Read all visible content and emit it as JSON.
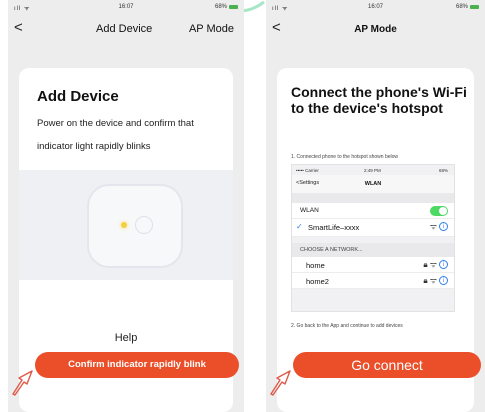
{
  "left_screen": {
    "status": {
      "time": "16:07",
      "battery": "68%"
    },
    "nav": {
      "back": "<",
      "title": "Add Device",
      "right_button": "AP Mode"
    },
    "card": {
      "title": "Add Device",
      "description": "Power on the device and confirm that indicator light rapidly blinks",
      "help": "Help",
      "confirm_button": "Confirm indicator rapidly blink"
    }
  },
  "right_screen": {
    "status": {
      "time": "16:07",
      "battery": "68%"
    },
    "nav": {
      "back": "<",
      "title": "AP Mode"
    },
    "card": {
      "title": "Connect the phone's Wi-Fi to the device's hotspot",
      "step1": "1. Connected phone to the hotspot shown below",
      "mini_screen": {
        "carrier": "••••• Carrier",
        "time": "2:49 PM",
        "battery": "68%",
        "back": "Settings",
        "title": "WLAN",
        "wlan_label": "WLAN",
        "connected_network": "SmartLife–xxxx",
        "choose_label": "CHOOSE A NETWORK...",
        "networks": [
          "home",
          "home2"
        ]
      },
      "step2": "2. Go back to the App and continue to add devices",
      "go_button": "Go connect"
    }
  },
  "colors": {
    "accent": "#ea4f2a",
    "toggle": "#4cd964",
    "link": "#2f80ed"
  }
}
